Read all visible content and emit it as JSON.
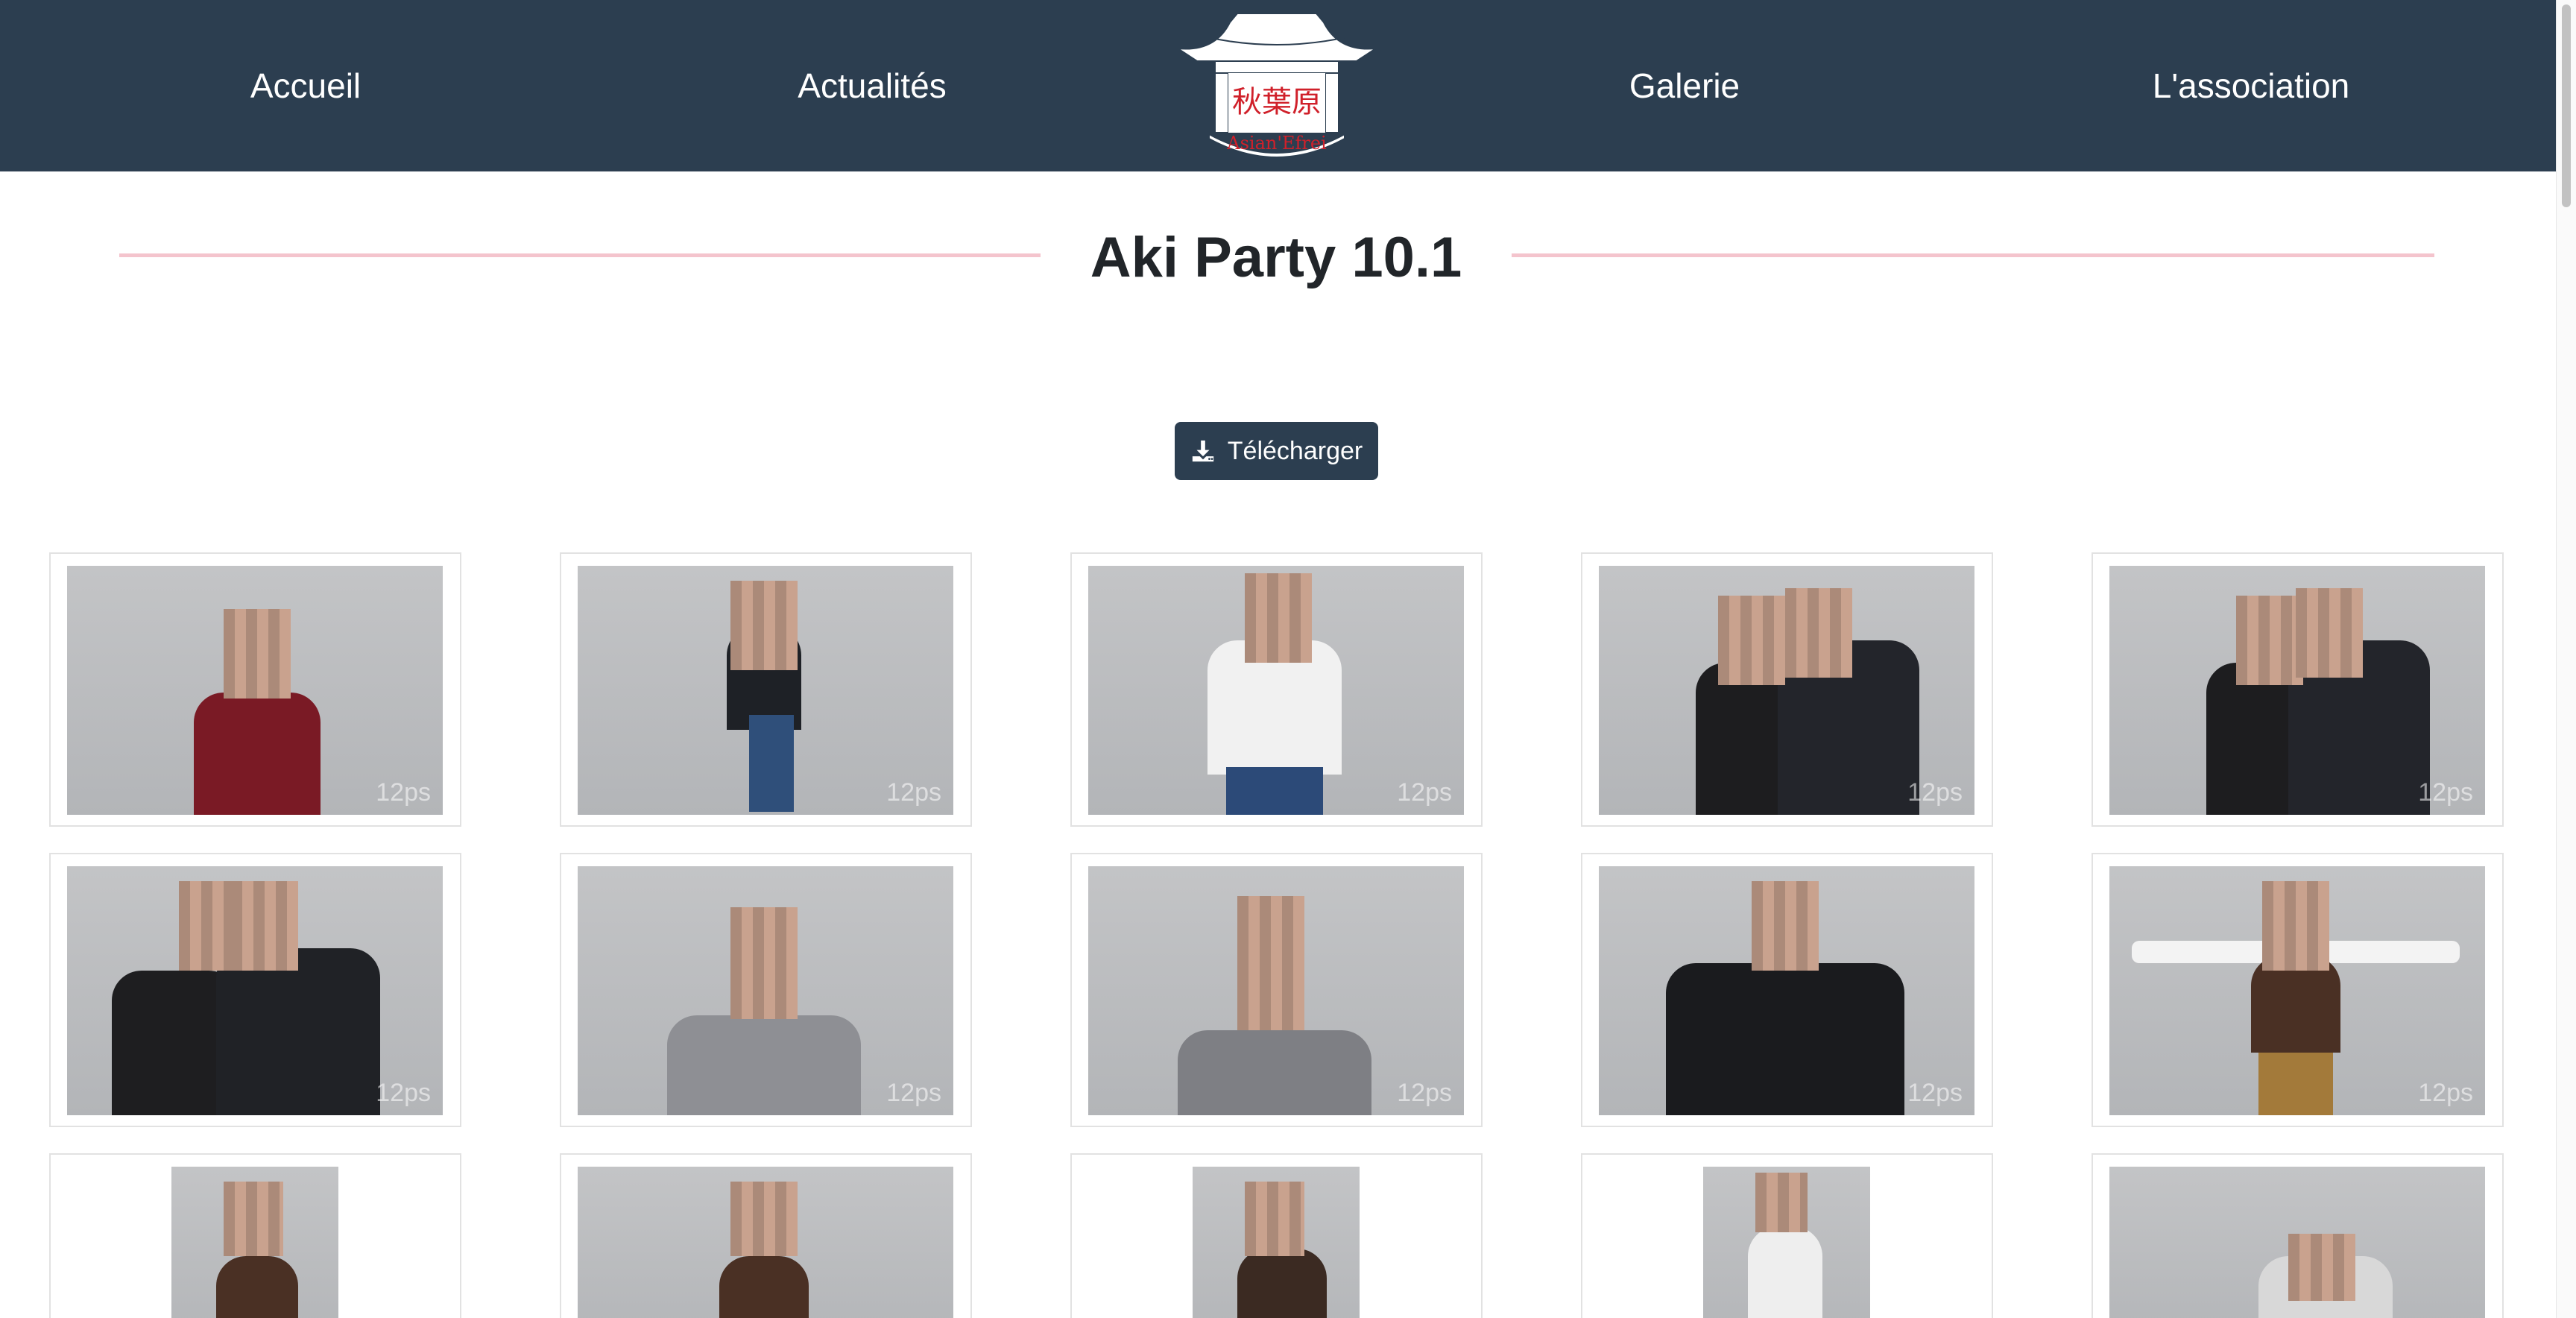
{
  "nav": {
    "home": "Accueil",
    "news": "Actualités",
    "gallery": "Galerie",
    "association": "L'association"
  },
  "logo": {
    "kanji": "秋葉原",
    "name": "Asian'Efrei"
  },
  "album": {
    "title": "Aki Party 10.1",
    "download_label": "Télécharger"
  },
  "photos": {
    "watermark": "12ps"
  },
  "colors": {
    "header_bg": "#2c3e50",
    "title_accent": "#f4c4cd",
    "logo_red": "#d0202a"
  }
}
